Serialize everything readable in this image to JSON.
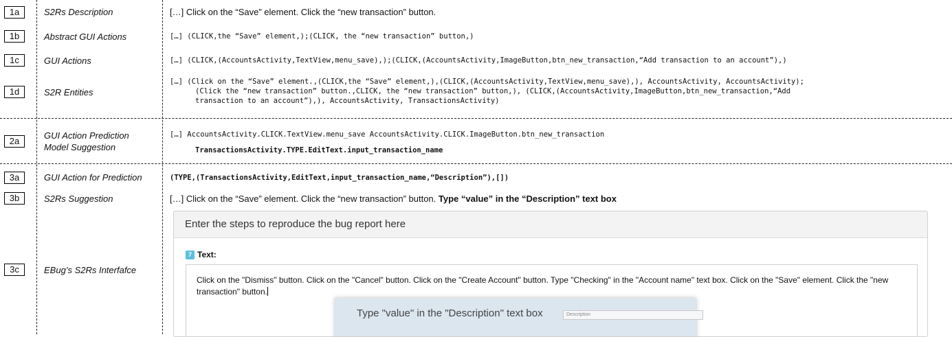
{
  "rows": {
    "r1a": {
      "tag": "1a",
      "label": "S2Rs Description",
      "content": "[…] Click on the “Save” element. Click the “new transaction” button."
    },
    "r1b": {
      "tag": "1b",
      "label": "Abstract GUI Actions",
      "content": "[…] (CLICK,the “Save” element,);(CLICK, the “new transaction” button,)"
    },
    "r1c": {
      "tag": "1c",
      "label": "GUI Actions",
      "content": "[…] (CLICK,(AccountsActivity,TextView,menu_save),);(CLICK,(AccountsActivity,ImageButton,btn_new_transaction,“Add transaction to an account”),)"
    },
    "r1d": {
      "tag": "1d",
      "label": "S2R Entities",
      "lines": [
        "[…] (Click on the “Save” element.,(CLICK,the “Save” element,),(CLICK,(AccountsActivity,TextView,menu_save),), AccountsActivity, AccountsActivity);",
        "(Click the “new transaction” button.,CLICK, the “new transaction” button,), (CLICK,(AccountsActivity,ImageButton,btn_new_transaction,“Add",
        " transaction to an account”),), AccountsActivity, TransactionsActivity)"
      ]
    },
    "r2a": {
      "tag": "2a",
      "label_line1": "GUI Action Prediction",
      "label_line2": "Model Suggestion",
      "line1": "[…] AccountsActivity.CLICK.TextView.menu_save AccountsActivity.CLICK.ImageButton.btn_new_transaction",
      "line2": "TransactionsActivity.TYPE.EditText.input_transaction_name"
    },
    "r3a": {
      "tag": "3a",
      "label": "GUI Action for Prediction",
      "content": "(TYPE,(TransactionsActivity,EditText,input_transaction_name,“Description”),[])"
    },
    "r3b": {
      "tag": "3b",
      "label": "S2Rs Suggestion",
      "content_plain": "[…] Click on the “Save” element. Click the “new transaction” button. ",
      "content_bold": "Type “value” in the “Description” text box"
    },
    "r3c": {
      "tag": "3c",
      "label": "EBug’s S2Rs Interfafce"
    }
  },
  "panel": {
    "header": "Enter the steps to reproduce the bug report here",
    "step_number": "7",
    "step_label": "Text:",
    "text_value": "Click on the \"Dismiss\" button. Click on the \"Cancel\" button. Click on the \"Create Account\" button. Type \"Checking\" in the \"Account name\" text box. Click on the \"Save\" element. Click the \"new transaction\" button.",
    "suggestion": "Type \"value\" in the \"Description\" text box",
    "suggestion_placeholder": "Description"
  },
  "colors": {
    "badge": "#5bc0de",
    "suggestion_bg": "#dbe6ef"
  }
}
